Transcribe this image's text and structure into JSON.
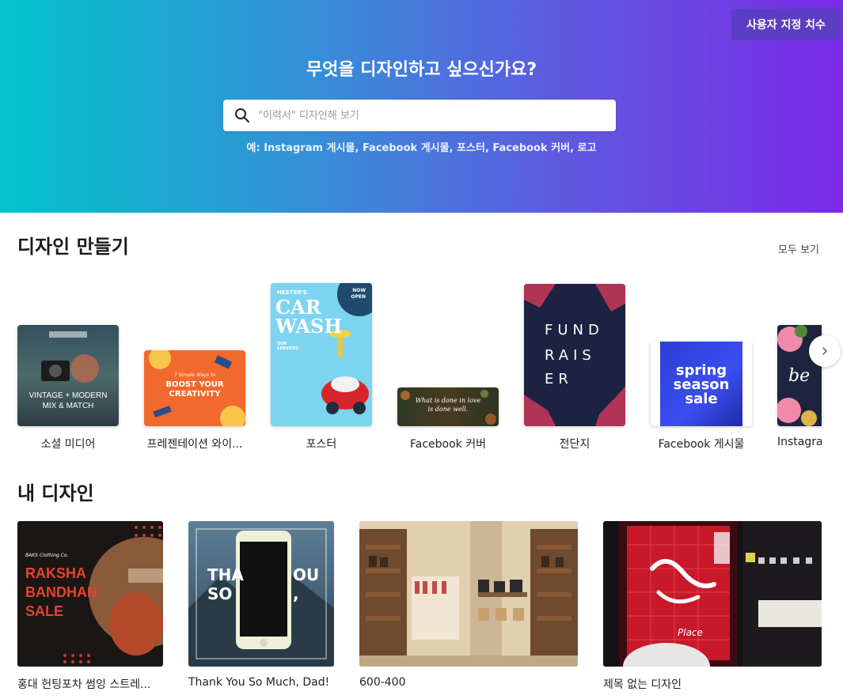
{
  "hero": {
    "custom_size_button": "사용자 지정 치수",
    "title": "무엇을 디자인하고 싶으신가요?",
    "search_placeholder": "\"이력서\" 디자인해 보기",
    "examples_prefix": "예:",
    "examples": [
      "Instagram 게시물",
      "Facebook 게시물",
      "포스터",
      "Facebook 커버",
      "로고"
    ],
    "gradient": [
      "#02c3cc",
      "#7c2ae8"
    ]
  },
  "create": {
    "title": "디자인 만들기",
    "see_all": "모두 보기",
    "templates": [
      {
        "label": "소셜 미디어",
        "thumb_lines": [
          "VINTAGE + MODERN",
          "MIX & MATCH"
        ]
      },
      {
        "label": "프레젠테이션 와이...",
        "thumb_lines": [
          "BOOST YOUR",
          "CREATIVITY",
          "7 Simple Ways to"
        ]
      },
      {
        "label": "포스터",
        "thumb_lines": [
          "HESTER'S",
          "CAR",
          "WASH",
          "NOW",
          "OPEN",
          "OUR SERVICES"
        ]
      },
      {
        "label": "Facebook 커버",
        "thumb_lines": [
          "What is done in love",
          "is done well."
        ]
      },
      {
        "label": "전단지",
        "thumb_lines": [
          "FUND",
          "RAIS",
          "ER"
        ]
      },
      {
        "label": "Facebook 게시물",
        "thumb_lines": [
          "spring",
          "season",
          "sale"
        ]
      },
      {
        "label": "Instagra",
        "thumb_lines": [
          "be"
        ]
      }
    ]
  },
  "mine": {
    "title": "내 디자인",
    "designs": [
      {
        "label": "홍대 헌팅포차 썸잉 스트레...",
        "thumb_lines": [
          "RAKSHA",
          "BANDHAN",
          "SALE",
          "BAKS Clothing Co."
        ]
      },
      {
        "label": "Thank You So Much, Dad!",
        "thumb_lines": [
          "THA",
          "OU",
          "SO",
          ","
        ]
      },
      {
        "label": "600-400",
        "thumb_lines": []
      },
      {
        "label": "제목 없는 디자인",
        "thumb_lines": [
          "Place"
        ]
      }
    ]
  },
  "icons": {
    "search": "search-icon",
    "next": "chevron-right-icon"
  }
}
